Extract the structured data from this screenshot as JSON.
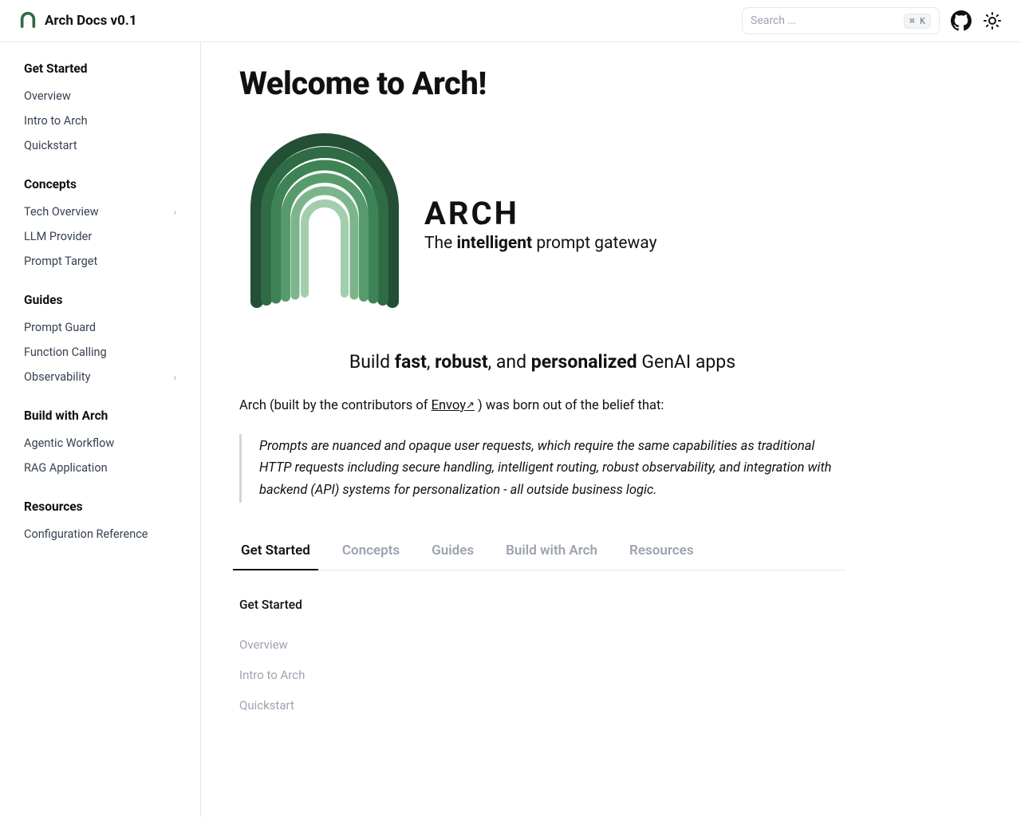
{
  "header": {
    "title": "Arch Docs v0.1",
    "search_placeholder": "Search ...",
    "search_kbd": "⌘ K"
  },
  "sidebar": [
    {
      "heading": "Get Started",
      "items": [
        {
          "label": "Overview"
        },
        {
          "label": "Intro to Arch"
        },
        {
          "label": "Quickstart"
        }
      ]
    },
    {
      "heading": "Concepts",
      "items": [
        {
          "label": "Tech Overview",
          "expandable": true
        },
        {
          "label": "LLM Provider"
        },
        {
          "label": "Prompt Target"
        }
      ]
    },
    {
      "heading": "Guides",
      "items": [
        {
          "label": "Prompt Guard"
        },
        {
          "label": "Function Calling"
        },
        {
          "label": "Observability",
          "expandable": true
        }
      ]
    },
    {
      "heading": "Build with Arch",
      "items": [
        {
          "label": "Agentic Workflow"
        },
        {
          "label": "RAG Application"
        }
      ]
    },
    {
      "heading": "Resources",
      "items": [
        {
          "label": "Configuration Reference"
        }
      ]
    }
  ],
  "page": {
    "title": "Welcome to Arch!",
    "hero_brand": "ARCH",
    "hero_tag_pre": "The ",
    "hero_tag_strong": "intelligent",
    "hero_tag_post": " prompt gateway",
    "subhead_pre": "Build ",
    "subhead_b1": "fast",
    "subhead_sep1": ", ",
    "subhead_b2": "robust",
    "subhead_sep2": ", and ",
    "subhead_b3": "personalized",
    "subhead_post": " GenAI apps",
    "intro_pre": "Arch (built by the contributors of ",
    "intro_link": "Envoy",
    "intro_post": " ) was born out of the belief that:",
    "quote": "Prompts are nuanced and opaque user requests, which require the same capabilities as traditional HTTP requests including secure handling, intelligent routing, robust observability, and integration with backend (API) systems for personalization - all outside business logic.",
    "tabs": [
      "Get Started",
      "Concepts",
      "Guides",
      "Build with Arch",
      "Resources"
    ],
    "active_tab": 0,
    "panel_heading": "Get Started",
    "panel_links": [
      "Overview",
      "Intro to Arch",
      "Quickstart"
    ]
  }
}
